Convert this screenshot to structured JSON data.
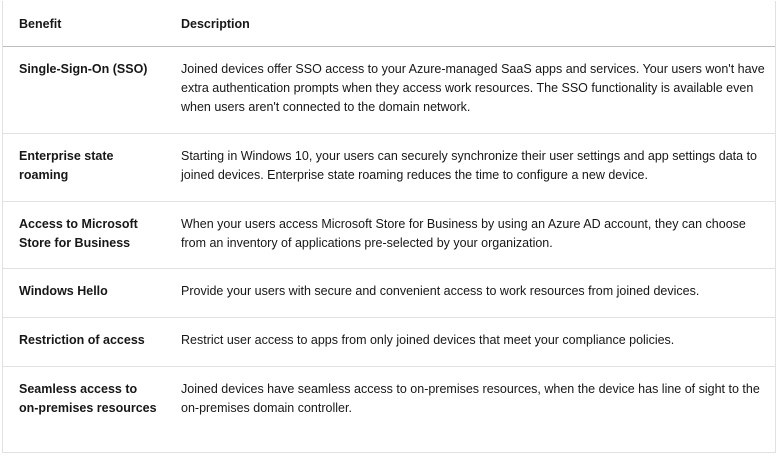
{
  "table": {
    "headers": {
      "benefit": "Benefit",
      "description": "Description"
    },
    "rows": [
      {
        "benefit": "Single-Sign-On (SSO)",
        "description": "Joined devices offer SSO access to your Azure-managed SaaS apps and services. Your users won't have extra authentication prompts when they access work resources. The SSO functionality is available even when users aren't connected to the domain network."
      },
      {
        "benefit": "Enterprise state roaming",
        "description": "Starting in Windows 10, your users can securely synchronize their user settings and app settings data to joined devices. Enterprise state roaming reduces the time to configure a new device."
      },
      {
        "benefit": "Access to Microsoft Store for Business",
        "description": "When your users access Microsoft Store for Business by using an Azure AD account, they can choose from an inventory of applications pre-selected by your organization."
      },
      {
        "benefit": "Windows Hello",
        "description": "Provide your users with secure and convenient access to work resources from joined devices."
      },
      {
        "benefit": "Restriction of access",
        "description": "Restrict user access to apps from only joined devices that meet your compliance policies."
      },
      {
        "benefit": "Seamless access to on-premises resources",
        "description": "Joined devices have seamless access to on-premises resources, when the device has line of sight to the on-premises domain controller."
      }
    ]
  }
}
